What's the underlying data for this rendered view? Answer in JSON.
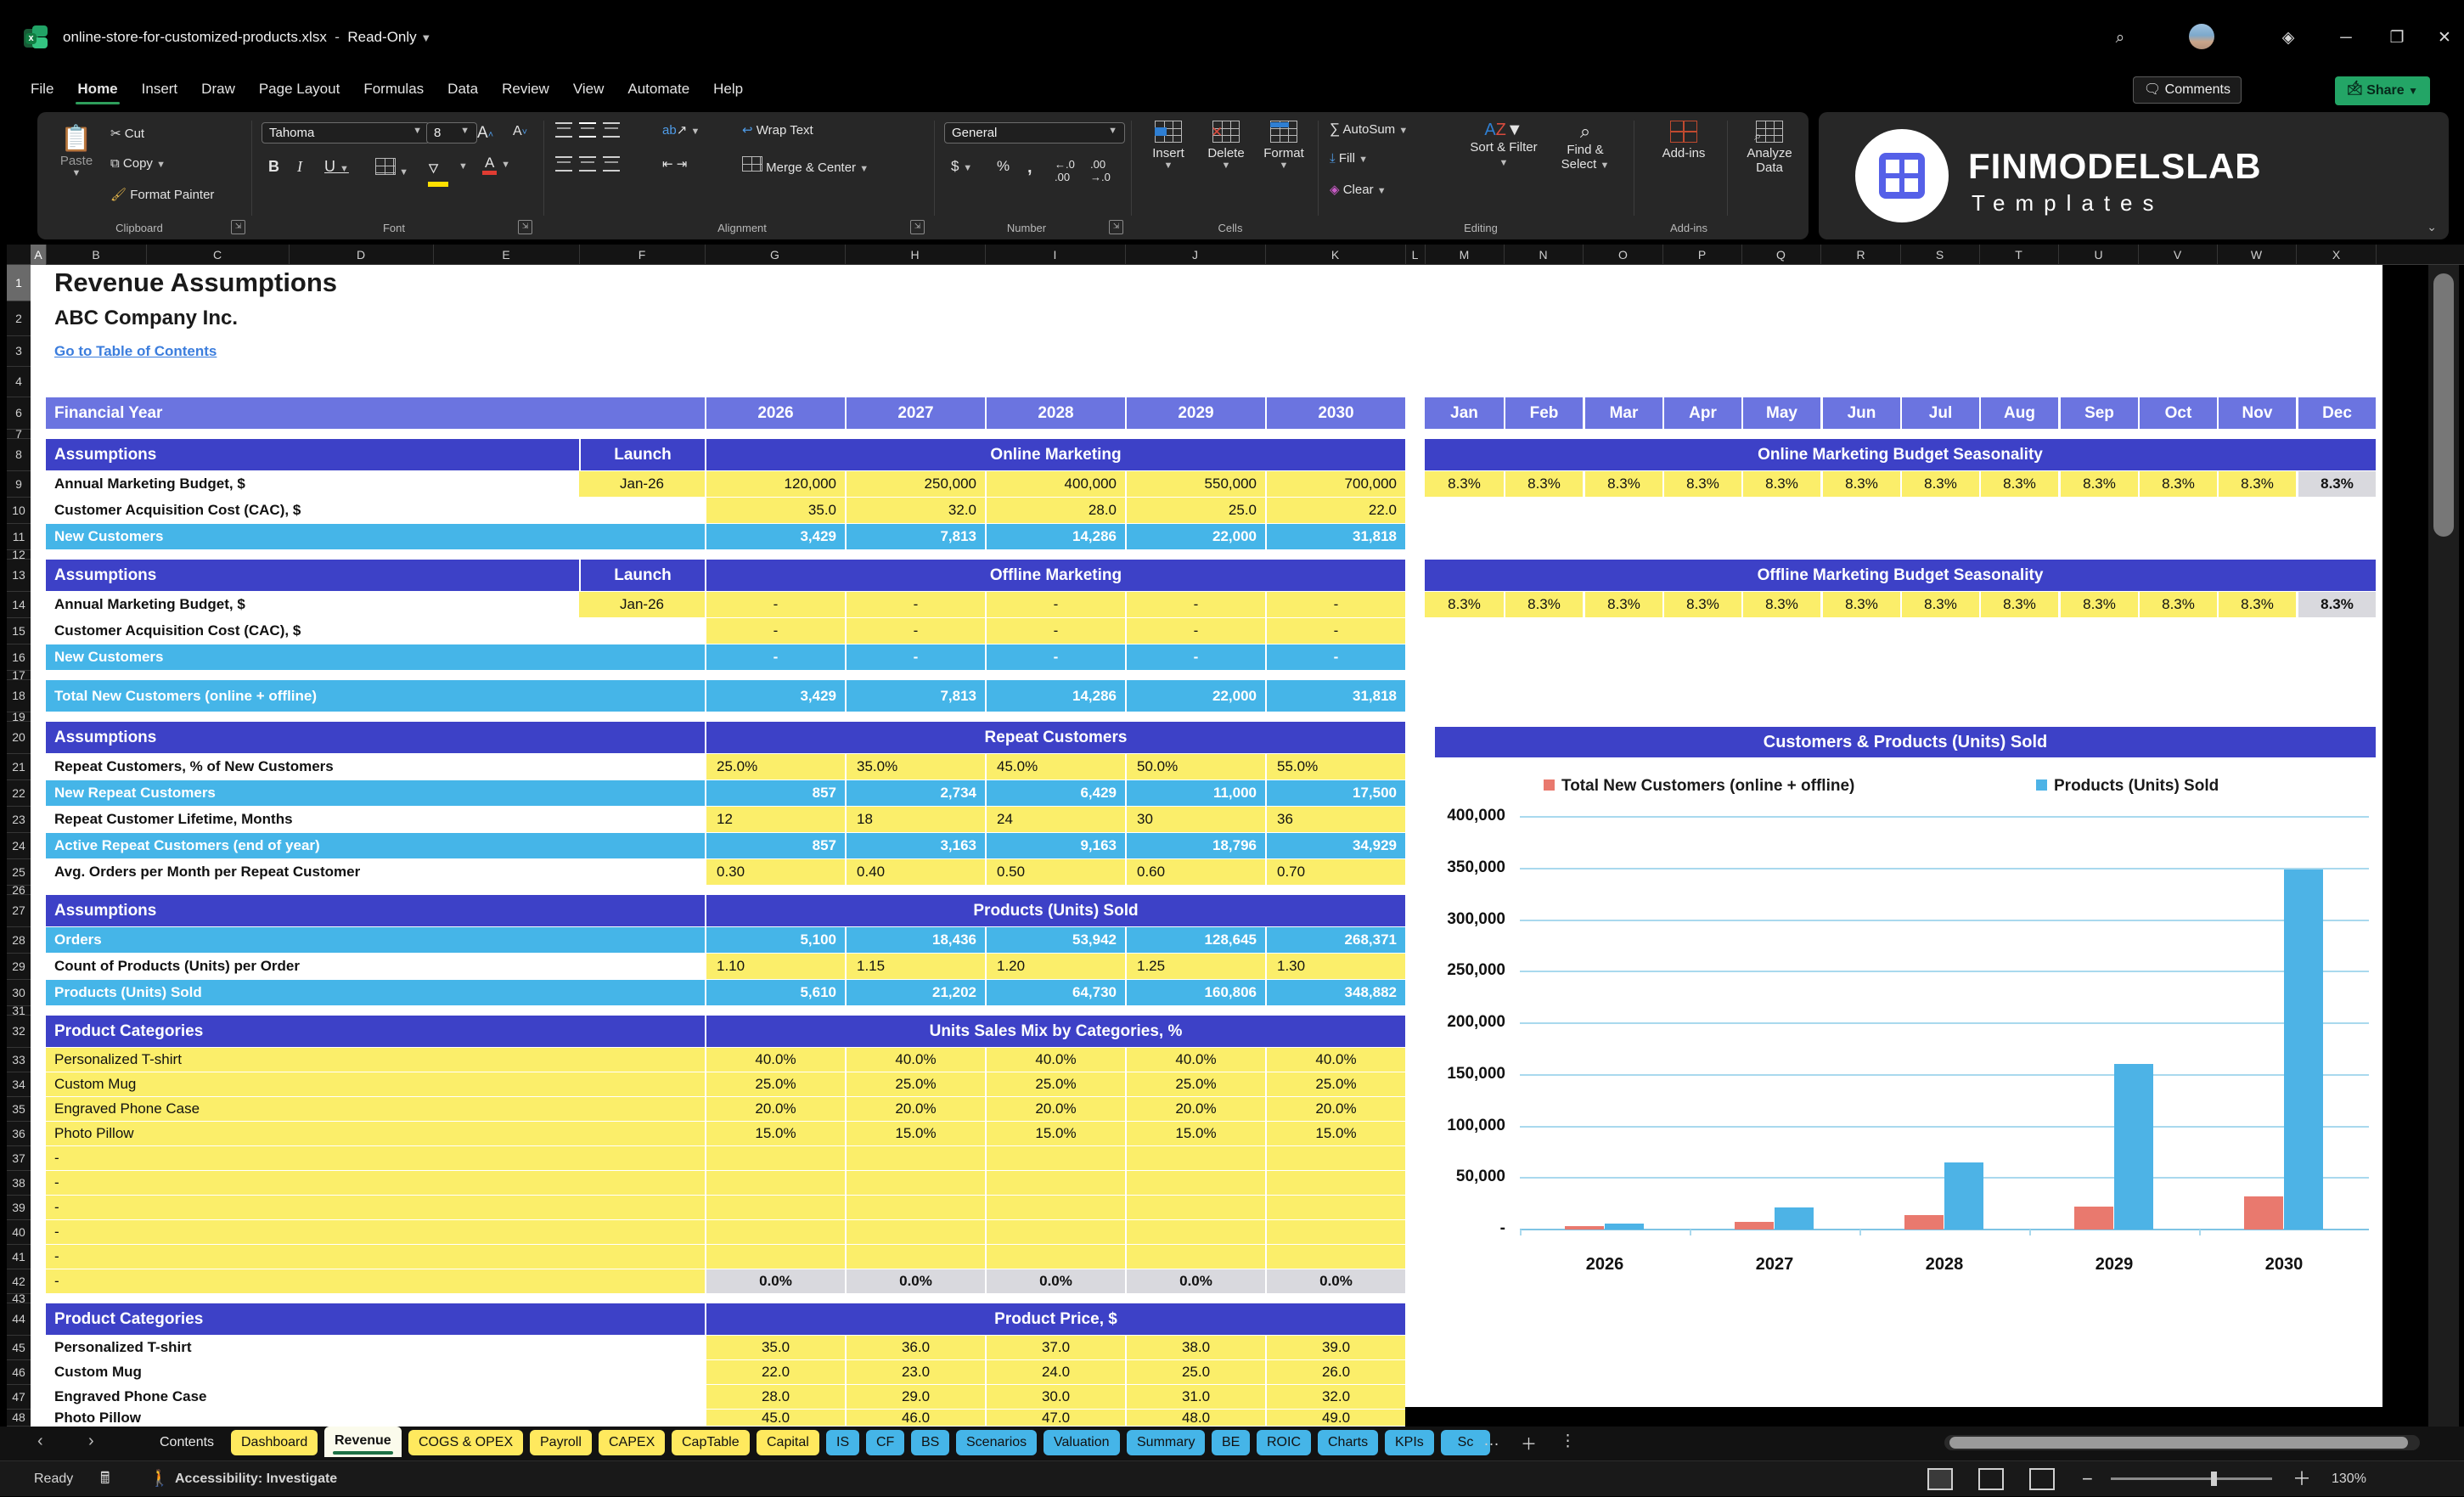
{
  "colors": {
    "banner": "#6B74E0",
    "header": "#3D41C7",
    "calc": "#45B5E8",
    "input": "#FBEE6A",
    "gray": "#D9D9DE",
    "link": "#3B7DDD",
    "series1": "#E9796E",
    "series2": "#4DB3E6",
    "tab_yellow": "#FFE95E",
    "tab_blue": "#45B5E8"
  },
  "window": {
    "filename": "online-store-for-customized-products.xlsx",
    "mode": "Read-Only",
    "menu": [
      "File",
      "Home",
      "Insert",
      "Draw",
      "Page Layout",
      "Formulas",
      "Data",
      "Review",
      "View",
      "Automate",
      "Help"
    ],
    "active_menu": "Home",
    "comments_label": "Comments",
    "share_label": "Share"
  },
  "ribbon": {
    "clipboard": {
      "paste": "Paste",
      "cut": "Cut",
      "copy": "Copy",
      "format_painter": "Format Painter",
      "group": "Clipboard"
    },
    "font": {
      "family": "Tahoma",
      "size": "8",
      "group": "Font"
    },
    "alignment": {
      "wrap": "Wrap Text",
      "merge": "Merge & Center",
      "group": "Alignment"
    },
    "number": {
      "format": "General",
      "group": "Number"
    },
    "cells": {
      "insert": "Insert",
      "delete": "Delete",
      "format": "Format",
      "group": "Cells"
    },
    "editing": {
      "autosum": "AutoSum",
      "fill": "Fill",
      "clear": "Clear",
      "sort": "Sort & Filter",
      "find": "Find & Select",
      "group": "Editing"
    },
    "addins": {
      "label": "Add-ins",
      "group": "Add-ins"
    },
    "analyze": {
      "label": "Analyze Data"
    }
  },
  "brand": {
    "name": "FINMODELSLAB",
    "sub": "Templates"
  },
  "grid": {
    "columns": [
      "A",
      "B",
      "C",
      "D",
      "E",
      "F",
      "G",
      "H",
      "I",
      "J",
      "K",
      "L",
      "M",
      "N",
      "O",
      "P",
      "Q",
      "R",
      "S",
      "T",
      "U",
      "V",
      "W",
      "X"
    ],
    "rows": [
      "1",
      "2",
      "3",
      "4",
      "6",
      "7",
      "8",
      "9",
      "10",
      "11",
      "12",
      "13",
      "14",
      "15",
      "16",
      "17",
      "18",
      "19",
      "20",
      "21",
      "22",
      "23",
      "24",
      "25",
      "26",
      "27",
      "28",
      "29",
      "30",
      "31",
      "32",
      "33",
      "34",
      "35",
      "36",
      "37",
      "38",
      "39",
      "40",
      "41",
      "42",
      "43",
      "44",
      "45",
      "46",
      "47",
      "48"
    ]
  },
  "sheet": {
    "title": "Revenue Assumptions",
    "company": "ABC Company Inc.",
    "toc_link": "Go to Table of Contents",
    "financial_year": {
      "label": "Financial Year",
      "years": [
        "2026",
        "2027",
        "2028",
        "2029",
        "2030"
      ]
    },
    "months": [
      "Jan",
      "Feb",
      "Mar",
      "Apr",
      "May",
      "Jun",
      "Jul",
      "Aug",
      "Sep",
      "Oct",
      "Nov",
      "Dec"
    ],
    "online": {
      "assumptions": "Assumptions",
      "launch": "Launch",
      "title": "Online Marketing",
      "budget": {
        "label": "Annual Marketing Budget, $",
        "launch": "Jan-26",
        "values": [
          "120,000",
          "250,000",
          "400,000",
          "550,000",
          "700,000"
        ]
      },
      "cac": {
        "label": "Customer Acquisition Cost (CAC), $",
        "values": [
          "35.0",
          "32.0",
          "28.0",
          "25.0",
          "22.0"
        ]
      },
      "new_customers": {
        "label": "New Customers",
        "values": [
          "3,429",
          "7,813",
          "14,286",
          "22,000",
          "31,818"
        ]
      },
      "seasonality": {
        "title": "Online Marketing Budget Seasonality",
        "values": [
          "8.3%",
          "8.3%",
          "8.3%",
          "8.3%",
          "8.3%",
          "8.3%",
          "8.3%",
          "8.3%",
          "8.3%",
          "8.3%",
          "8.3%",
          "8.3%"
        ]
      }
    },
    "offline": {
      "assumptions": "Assumptions",
      "launch": "Launch",
      "title": "Offline Marketing",
      "budget": {
        "label": "Annual Marketing Budget, $",
        "launch": "Jan-26",
        "values": [
          "-",
          "-",
          "-",
          "-",
          "-"
        ]
      },
      "cac": {
        "label": "Customer Acquisition Cost (CAC), $",
        "values": [
          "-",
          "-",
          "-",
          "-",
          "-"
        ]
      },
      "new_customers": {
        "label": "New Customers",
        "values": [
          "-",
          "-",
          "-",
          "-",
          "-"
        ]
      },
      "seasonality": {
        "title": "Offline Marketing Budget Seasonality",
        "values": [
          "8.3%",
          "8.3%",
          "8.3%",
          "8.3%",
          "8.3%",
          "8.3%",
          "8.3%",
          "8.3%",
          "8.3%",
          "8.3%",
          "8.3%",
          "8.3%"
        ]
      }
    },
    "total": {
      "label": "Total New Customers (online + offline)",
      "values": [
        "3,429",
        "7,813",
        "14,286",
        "22,000",
        "31,818"
      ]
    },
    "repeat": {
      "assumptions": "Assumptions",
      "title": "Repeat Customers",
      "rows": [
        {
          "label": "Repeat Customers, % of New Customers",
          "style": "input",
          "values": [
            "25.0%",
            "35.0%",
            "45.0%",
            "50.0%",
            "55.0%"
          ]
        },
        {
          "label": "New Repeat Customers",
          "style": "calc",
          "values": [
            "857",
            "2,734",
            "6,429",
            "11,000",
            "17,500"
          ]
        },
        {
          "label": "Repeat Customer Lifetime, Months",
          "style": "input",
          "values": [
            "12",
            "18",
            "24",
            "30",
            "36"
          ]
        },
        {
          "label": "Active Repeat Customers (end of year)",
          "style": "calc",
          "values": [
            "857",
            "3,163",
            "9,163",
            "18,796",
            "34,929"
          ]
        },
        {
          "label": "Avg. Orders per Month per Repeat Customer",
          "style": "input",
          "values": [
            "0.30",
            "0.40",
            "0.50",
            "0.60",
            "0.70"
          ]
        }
      ]
    },
    "products": {
      "assumptions": "Assumptions",
      "title": "Products (Units) Sold",
      "rows": [
        {
          "label": "Orders",
          "style": "calc",
          "values": [
            "5,100",
            "18,436",
            "53,942",
            "128,645",
            "268,371"
          ]
        },
        {
          "label": "Count of Products (Units) per Order",
          "style": "input",
          "values": [
            "1.10",
            "1.15",
            "1.20",
            "1.25",
            "1.30"
          ]
        },
        {
          "label": "Products (Units) Sold",
          "style": "calc",
          "values": [
            "5,610",
            "21,202",
            "64,730",
            "160,806",
            "348,882"
          ]
        }
      ]
    },
    "mix": {
      "header": "Product Categories",
      "title": "Units Sales Mix by Categories, %",
      "rows": [
        {
          "label": "Personalized T-shirt",
          "values": [
            "40.0%",
            "40.0%",
            "40.0%",
            "40.0%",
            "40.0%"
          ],
          "style": "input"
        },
        {
          "label": "Custom Mug",
          "values": [
            "25.0%",
            "25.0%",
            "25.0%",
            "25.0%",
            "25.0%"
          ],
          "style": "input"
        },
        {
          "label": "Engraved Phone Case",
          "values": [
            "20.0%",
            "20.0%",
            "20.0%",
            "20.0%",
            "20.0%"
          ],
          "style": "input"
        },
        {
          "label": "Photo Pillow",
          "values": [
            "15.0%",
            "15.0%",
            "15.0%",
            "15.0%",
            "15.0%"
          ],
          "style": "input"
        },
        {
          "label": "-",
          "values": [
            "",
            "",
            "",
            "",
            ""
          ],
          "style": "input"
        },
        {
          "label": "-",
          "values": [
            "",
            "",
            "",
            "",
            ""
          ],
          "style": "input"
        },
        {
          "label": "-",
          "values": [
            "",
            "",
            "",
            "",
            ""
          ],
          "style": "input"
        },
        {
          "label": "-",
          "values": [
            "",
            "",
            "",
            "",
            ""
          ],
          "style": "input"
        },
        {
          "label": "-",
          "values": [
            "",
            "",
            "",
            "",
            ""
          ],
          "style": "input"
        },
        {
          "label": "-",
          "values": [
            "0.0%",
            "0.0%",
            "0.0%",
            "0.0%",
            "0.0%"
          ],
          "style": "gray"
        }
      ]
    },
    "price": {
      "header": "Product Categories",
      "title": "Product Price, $",
      "rows": [
        {
          "label": "Personalized T-shirt",
          "values": [
            "35.0",
            "36.0",
            "37.0",
            "38.0",
            "39.0"
          ]
        },
        {
          "label": "Custom Mug",
          "values": [
            "22.0",
            "23.0",
            "24.0",
            "25.0",
            "26.0"
          ]
        },
        {
          "label": "Engraved Phone Case",
          "values": [
            "28.0",
            "29.0",
            "30.0",
            "31.0",
            "32.0"
          ]
        },
        {
          "label": "Photo Pillow",
          "values": [
            "45.0",
            "46.0",
            "47.0",
            "48.0",
            "49.0"
          ]
        }
      ]
    }
  },
  "chart_data": {
    "type": "bar",
    "title": "Customers & Products (Units) Sold",
    "categories": [
      "2026",
      "2027",
      "2028",
      "2029",
      "2030"
    ],
    "series": [
      {
        "name": "Total New Customers (online + offline)",
        "color": "#E9796E",
        "values": [
          3429,
          7813,
          14286,
          22000,
          31818
        ]
      },
      {
        "name": "Products (Units) Sold",
        "color": "#4DB3E6",
        "values": [
          5610,
          21202,
          64730,
          160806,
          348882
        ]
      }
    ],
    "ylim": [
      0,
      400000
    ],
    "ytick_step": 50000,
    "ytick_labels": [
      "-",
      "50,000",
      "100,000",
      "150,000",
      "200,000",
      "250,000",
      "300,000",
      "350,000",
      "400,000"
    ],
    "grid": true,
    "legend_position": "top"
  },
  "tabs": {
    "items": [
      {
        "label": "Contents",
        "style": "dark"
      },
      {
        "label": "Dashboard",
        "style": "yellow"
      },
      {
        "label": "Revenue",
        "style": "active"
      },
      {
        "label": "COGS & OPEX",
        "style": "yellow"
      },
      {
        "label": "Payroll",
        "style": "yellow"
      },
      {
        "label": "CAPEX",
        "style": "yellow"
      },
      {
        "label": "CapTable",
        "style": "yellow"
      },
      {
        "label": "Capital",
        "style": "yellow"
      },
      {
        "label": "IS",
        "style": "blue"
      },
      {
        "label": "CF",
        "style": "blue"
      },
      {
        "label": "BS",
        "style": "blue"
      },
      {
        "label": "Scenarios",
        "style": "blue"
      },
      {
        "label": "Valuation",
        "style": "blue"
      },
      {
        "label": "Summary",
        "style": "blue"
      },
      {
        "label": "BE",
        "style": "blue"
      },
      {
        "label": "ROIC",
        "style": "blue"
      },
      {
        "label": "Charts",
        "style": "blue"
      },
      {
        "label": "KPIs",
        "style": "blue"
      },
      {
        "label": "Sc",
        "style": "blue"
      }
    ]
  },
  "status": {
    "ready": "Ready",
    "accessibility": "Accessibility: Investigate",
    "zoom": "130%"
  }
}
